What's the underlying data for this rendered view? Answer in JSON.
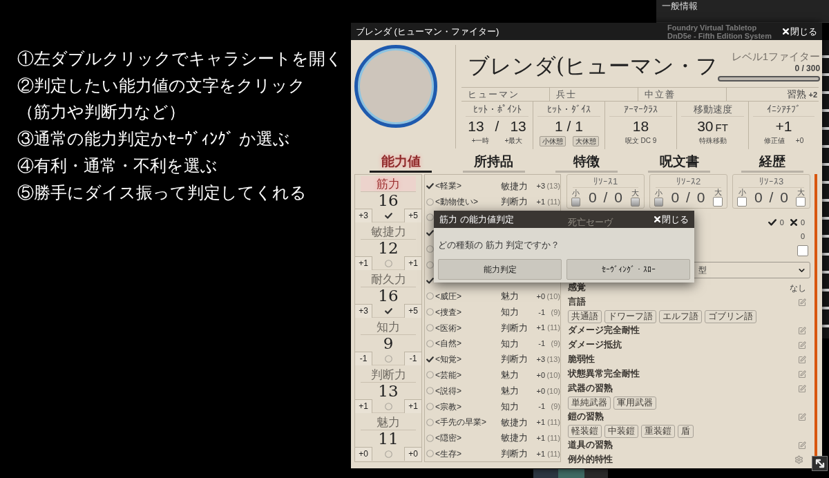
{
  "instructions": [
    "①左ダブルクリックでキャラシートを開く",
    "②判定したい能力値の文字をクリック",
    "（筋力や判断力など）",
    "③通常の能力判定かｾｰｳﾞｨﾝｸﾞ か選ぶ",
    "④有利・通常・不利を選ぶ",
    "⑤勝手にダイス振って判定してくれる"
  ],
  "sidebar": {
    "title": "一般情報",
    "lines": [
      "Foundry Virtual Tabletop",
      "DnD5e - Fifth Edition System"
    ]
  },
  "sheet": {
    "title": "ブレンダ (ヒューマン・ファイター)",
    "close": "閉じる",
    "name": "ブレンダ(ヒューマン・フ",
    "level": "レベル1ファイター",
    "xp": "0 / 300",
    "xp_bar": {
      "level": 0
    },
    "details": [
      "ヒューマン",
      "兵士",
      "中立善"
    ],
    "proficiency": {
      "label": "習熟",
      "value": "+2"
    },
    "stats": [
      {
        "kind": "pair",
        "label": "ﾋｯﾄ・ﾎﾟｲﾝﾄ",
        "values": [
          "13",
          "/",
          "13"
        ],
        "notes": [
          "+一時",
          "+最大"
        ]
      },
      {
        "kind": "rest",
        "label": "ﾋｯﾄ・ﾀﾞｲｽ",
        "value": "1 / 1",
        "buttons": [
          "小休憩",
          "大休憩"
        ]
      },
      {
        "kind": "number",
        "label": "ｱｰﾏｰｸﾗｽ",
        "value": "18",
        "notes": [
          "呪文 DC 9"
        ]
      },
      {
        "kind": "number",
        "label": "移動速度",
        "value": "30",
        "unit": "FT",
        "notes": [
          "特殊移動"
        ]
      },
      {
        "kind": "number",
        "label": "ｲﾆｼｱﾁﾌﾞ",
        "value": "+1",
        "notes": [
          "修正値",
          "+0"
        ]
      }
    ],
    "tabs": [
      {
        "label": "能力値",
        "selected": true
      },
      {
        "label": "所持品",
        "selected": false
      },
      {
        "label": "特徴",
        "selected": false
      },
      {
        "label": "呪文書",
        "selected": false
      },
      {
        "label": "経歴",
        "selected": false
      }
    ],
    "abilities": [
      {
        "name": "筋力",
        "score": "16",
        "mod": "+3",
        "save": "+5",
        "proficient": true,
        "selected": true
      },
      {
        "name": "敏捷力",
        "score": "12",
        "mod": "+1",
        "save": "+1",
        "proficient": false,
        "selected": false
      },
      {
        "name": "耐久力",
        "score": "16",
        "mod": "+3",
        "save": "+5",
        "proficient": true,
        "selected": false
      },
      {
        "name": "知力",
        "score": "9",
        "mod": "-1",
        "save": "-1",
        "proficient": false,
        "selected": false
      },
      {
        "name": "判断力",
        "score": "13",
        "mod": "+1",
        "save": "+1",
        "proficient": false,
        "selected": false
      },
      {
        "name": "魅力",
        "score": "11",
        "mod": "+0",
        "save": "+0",
        "proficient": false,
        "selected": false
      }
    ],
    "skills": [
      {
        "proficient": true,
        "name": "<軽業>",
        "ability": "敏捷力",
        "mod": "+3",
        "passive": "(13)"
      },
      {
        "proficient": false,
        "name": "<動物使い>",
        "ability": "判断力",
        "mod": "+1",
        "passive": "(11)"
      },
      {
        "proficient": false
      },
      {
        "proficient": true
      },
      {
        "proficient": false
      },
      {
        "proficient": false
      },
      {
        "proficient": true
      },
      {
        "proficient": false,
        "name": "<威圧>",
        "ability": "魅力",
        "mod": "+0",
        "passive": "(10)"
      },
      {
        "proficient": false,
        "name": "<捜査>",
        "ability": "知力",
        "mod": "-1",
        "passive": "(9)"
      },
      {
        "proficient": false,
        "name": "<医術>",
        "ability": "判断力",
        "mod": "+1",
        "passive": "(11)"
      },
      {
        "proficient": false,
        "name": "<自然>",
        "ability": "知力",
        "mod": "-1",
        "passive": "(9)"
      },
      {
        "proficient": true,
        "name": "<知覚>",
        "ability": "判断力",
        "mod": "+3",
        "passive": "(13)"
      },
      {
        "proficient": false,
        "name": "<芸能>",
        "ability": "魅力",
        "mod": "+0",
        "passive": "(10)"
      },
      {
        "proficient": false,
        "name": "<説得>",
        "ability": "魅力",
        "mod": "+0",
        "passive": "(10)"
      },
      {
        "proficient": false,
        "name": "<宗教>",
        "ability": "知力",
        "mod": "-1",
        "passive": "(9)"
      },
      {
        "proficient": false,
        "name": "<手先の早業>",
        "ability": "敏捷力",
        "mod": "+1",
        "passive": "(11)"
      },
      {
        "proficient": false,
        "name": "<隠密>",
        "ability": "敏捷力",
        "mod": "+1",
        "passive": "(11)"
      },
      {
        "proficient": false,
        "name": "<生存>",
        "ability": "判断力",
        "mod": "+1",
        "passive": "(11)"
      }
    ],
    "resources": [
      {
        "label": "ﾘｿｰｽ1",
        "value": "0 / 0",
        "short_label": "小",
        "long_label": "大",
        "short_disabled": true,
        "long_disabled": true
      },
      {
        "label": "ﾘｿｰｽ2",
        "value": "0 / 0",
        "short_label": "小",
        "long_label": "大",
        "short_disabled": true,
        "long_disabled": false
      },
      {
        "label": "ﾘｿｰｽ3",
        "value": "0 / 0",
        "short_label": "小",
        "long_label": "大",
        "short_disabled": false,
        "long_disabled": false
      }
    ],
    "status_rows": [
      {
        "kind": "death",
        "label": "死亡セーヴ",
        "successes": "0",
        "failures": "0"
      },
      {
        "kind": "number",
        "value": "0"
      },
      {
        "kind": "checkbox",
        "checked": false
      }
    ],
    "select": {
      "value": "型"
    },
    "traits": [
      {
        "kind": "plain",
        "label": "感覚",
        "value": "なし"
      },
      {
        "kind": "editable",
        "label": "言語",
        "tags": [
          "共通語",
          "ドワーフ語",
          "エルフ語",
          "ゴブリン語"
        ]
      },
      {
        "kind": "editable",
        "label": "ダメージ完全耐性"
      },
      {
        "kind": "editable",
        "label": "ダメージ抵抗"
      },
      {
        "kind": "editable",
        "label": "脆弱性"
      },
      {
        "kind": "editable",
        "label": "状態異常完全耐性"
      },
      {
        "kind": "editable",
        "label": "武器の習熟",
        "tags": [
          "単純武器",
          "軍用武器"
        ]
      },
      {
        "kind": "editable",
        "label": "鎧の習熟",
        "tags": [
          "軽装鎧",
          "中装鎧",
          "重装鎧",
          "盾"
        ]
      },
      {
        "kind": "editable",
        "label": "道具の習熟"
      },
      {
        "kind": "configurable",
        "label": "例外的特性"
      }
    ]
  },
  "dialog": {
    "title": "筋力 の能力値判定",
    "close": "閉じる",
    "question": "どの種類の 筋力 判定ですか？",
    "buttons": [
      "能力判定",
      "ｾｰｳﾞｨﾝｸﾞ・ｽﾛｰ"
    ]
  }
}
